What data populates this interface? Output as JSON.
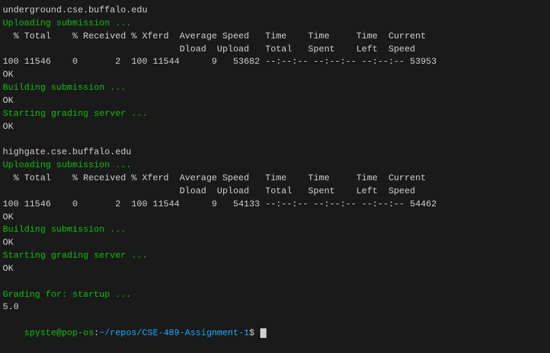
{
  "terminal": {
    "lines": [
      {
        "text": "underground.cse.buffalo.edu",
        "color": "white"
      },
      {
        "text": "Uploading submission ...",
        "color": "green"
      },
      {
        "text": "  % Total    % Received % Xferd  Average Speed   Time    Time     Time  Current",
        "color": "white"
      },
      {
        "text": "                                 Dload  Upload   Total   Spent    Left  Speed",
        "color": "white"
      },
      {
        "text": "100 11546    0       2  100 11544      9   53682 --:--:-- --:--:-- --:--:-- 53953",
        "color": "white"
      },
      {
        "text": "OK",
        "color": "white"
      },
      {
        "text": "Building submission ...",
        "color": "green"
      },
      {
        "text": "OK",
        "color": "white"
      },
      {
        "text": "Starting grading server ...",
        "color": "green"
      },
      {
        "text": "OK",
        "color": "white"
      },
      {
        "text": "",
        "color": "white"
      },
      {
        "text": "highgate.cse.buffalo.edu",
        "color": "white"
      },
      {
        "text": "Uploading submission ...",
        "color": "green"
      },
      {
        "text": "  % Total    % Received % Xferd  Average Speed   Time    Time     Time  Current",
        "color": "white"
      },
      {
        "text": "                                 Dload  Upload   Total   Spent    Left  Speed",
        "color": "white"
      },
      {
        "text": "100 11546    0       2  100 11544      9   54133 --:--:-- --:--:-- --:--:-- 54462",
        "color": "white"
      },
      {
        "text": "OK",
        "color": "white"
      },
      {
        "text": "Building submission ...",
        "color": "green"
      },
      {
        "text": "OK",
        "color": "white"
      },
      {
        "text": "Starting grading server ...",
        "color": "green"
      },
      {
        "text": "OK",
        "color": "white"
      },
      {
        "text": "",
        "color": "white"
      },
      {
        "text": "Grading for: startup ...",
        "color": "green"
      },
      {
        "text": "5.0",
        "color": "white"
      }
    ],
    "prompt": {
      "user": "spyste",
      "host": "pop-os",
      "path": "~/repos/CSE-489-Assignment-1",
      "dollar": "$"
    }
  }
}
